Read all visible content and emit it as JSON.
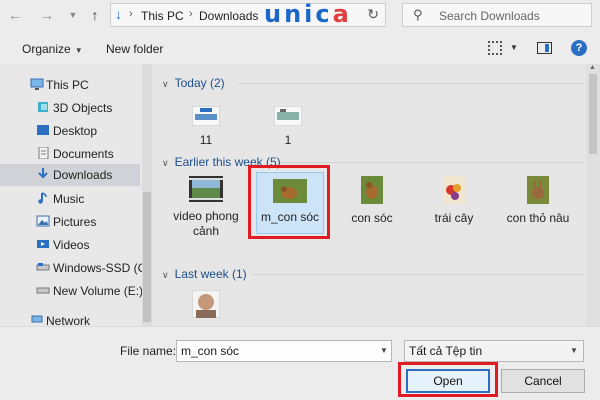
{
  "address": {
    "crumbs": [
      "This PC",
      "Downloads"
    ],
    "refresh_icon": "refresh-icon"
  },
  "logo": {
    "text_a": "unic",
    "text_b": "a"
  },
  "search": {
    "placeholder": "Search Downloads"
  },
  "toolbar": {
    "organize": "Organize",
    "new_folder": "New folder",
    "help": "?"
  },
  "nav": {
    "items": [
      {
        "label": "This PC",
        "icon": "computer-icon"
      },
      {
        "label": "3D Objects",
        "icon": "cube-icon"
      },
      {
        "label": "Desktop",
        "icon": "desktop-icon"
      },
      {
        "label": "Documents",
        "icon": "document-icon"
      },
      {
        "label": "Downloads",
        "icon": "download-icon",
        "selected": true
      },
      {
        "label": "Music",
        "icon": "music-icon"
      },
      {
        "label": "Pictures",
        "icon": "pictures-icon"
      },
      {
        "label": "Videos",
        "icon": "video-icon"
      },
      {
        "label": "Windows-SSD (C:)",
        "icon": "drive-icon"
      },
      {
        "label": "New Volume (E:)",
        "icon": "drive-icon"
      },
      {
        "label": "Network",
        "icon": "network-icon"
      }
    ]
  },
  "groups": {
    "today": {
      "label": "Today (2)",
      "files": [
        {
          "name": "11"
        },
        {
          "name": "1"
        }
      ]
    },
    "earlier": {
      "label": "Earlier this week (5)",
      "files": [
        {
          "name": "video phong cảnh"
        },
        {
          "name": "m_con sóc",
          "selected": true
        },
        {
          "name": "con sóc"
        },
        {
          "name": "trái cây"
        },
        {
          "name": "con thỏ nâu"
        }
      ]
    },
    "last_week": {
      "label": "Last week (1)"
    }
  },
  "footer": {
    "file_name_label": "File name:",
    "file_name_value": "m_con sóc",
    "file_type": "Tất cả Tệp tin",
    "open": "Open",
    "cancel": "Cancel"
  },
  "colors": {
    "accent": "#2b6fc2",
    "highlight": "#e01b22",
    "selection": "#cde3f7"
  }
}
